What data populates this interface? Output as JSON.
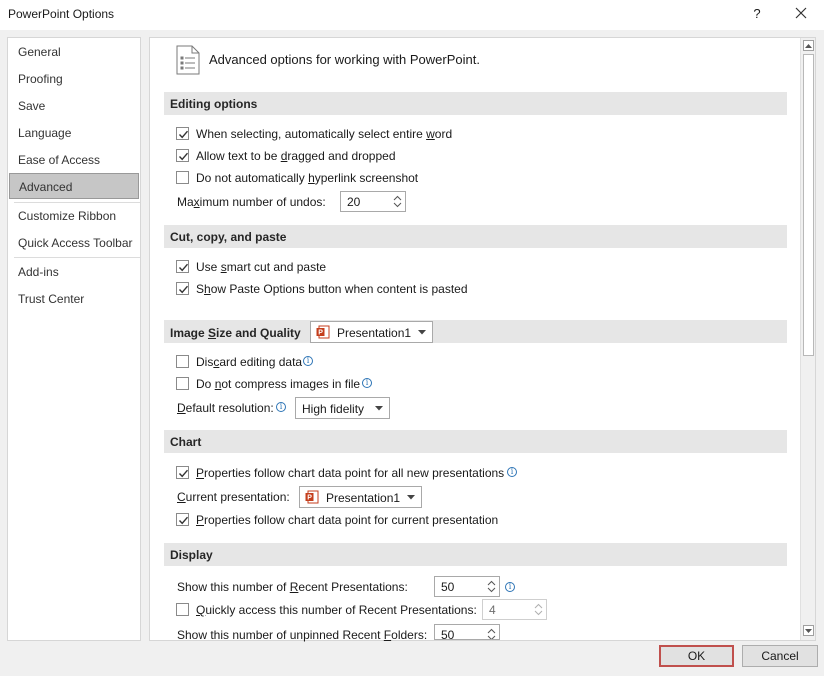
{
  "window": {
    "title": "PowerPoint Options",
    "help": "?"
  },
  "sidebar": {
    "items": [
      {
        "label": "General"
      },
      {
        "label": "Proofing"
      },
      {
        "label": "Save"
      },
      {
        "label": "Language"
      },
      {
        "label": "Ease of Access"
      },
      {
        "label": "Advanced",
        "selected": true
      },
      {
        "label": "Customize Ribbon"
      },
      {
        "label": "Quick Access Toolbar"
      },
      {
        "label": "Add-ins"
      },
      {
        "label": "Trust Center"
      }
    ]
  },
  "page": {
    "heading": "Advanced options for working with PowerPoint."
  },
  "editing": {
    "title": "Editing options",
    "opt1": {
      "pre": "When selecting, automatically select entire ",
      "u": "w",
      "post": "ord",
      "checked": true
    },
    "opt2": {
      "pre": "Allow text to be ",
      "u": "d",
      "post": "ragged and dropped",
      "checked": true
    },
    "opt3": {
      "pre": "Do not automatically ",
      "u": "h",
      "post": "yperlink screenshot",
      "checked": false
    },
    "undo": {
      "pre": "Ma",
      "u": "x",
      "post": "imum number of undos:",
      "value": "20"
    }
  },
  "cut": {
    "title": "Cut, copy, and paste",
    "opt1": {
      "pre": "Use ",
      "u": "s",
      "post": "mart cut and paste",
      "checked": true
    },
    "opt2": {
      "pre": "S",
      "u": "h",
      "post": "ow Paste Options button when content is pasted",
      "checked": true
    }
  },
  "image": {
    "title_pre": "Image ",
    "title_u": "S",
    "title_post": "ize and Quality",
    "doc": "Presentation1",
    "opt1": {
      "pre": "Dis",
      "u": "c",
      "post": "ard editing data",
      "checked": false
    },
    "opt2": {
      "pre": "Do ",
      "u": "n",
      "post": "ot compress images in file",
      "checked": false
    },
    "res": {
      "pre": "",
      "u": "D",
      "post": "efault resolution:",
      "value": "High fidelity"
    }
  },
  "chart": {
    "title": "Chart",
    "opt1": {
      "pre": "",
      "u": "P",
      "post": "roperties follow chart data point for all new presentations",
      "checked": true
    },
    "current": {
      "pre": "",
      "u": "C",
      "post": "urrent presentation:",
      "value": "Presentation1"
    },
    "opt2": {
      "pre": "",
      "u": "P",
      "post": "roperties follow chart data point for current presentation",
      "checked": true
    }
  },
  "display": {
    "title": "Display",
    "recent": {
      "pre": "Show this number of ",
      "u": "R",
      "post": "ecent Presentations:",
      "value": "50"
    },
    "quick": {
      "pre": "",
      "u": "Q",
      "post": "uickly access this number of Recent Presentations:",
      "value": "4",
      "checked": false
    },
    "folders": {
      "pre": "Show this number of unpinned Recent ",
      "u": "F",
      "post": "olders:",
      "value": "50"
    }
  },
  "buttons": {
    "ok": "OK",
    "cancel": "Cancel"
  },
  "colors": {
    "accent": "#c0504d",
    "check": "#333333",
    "info": "#2e75b6",
    "ppt": "#c43e1c"
  }
}
